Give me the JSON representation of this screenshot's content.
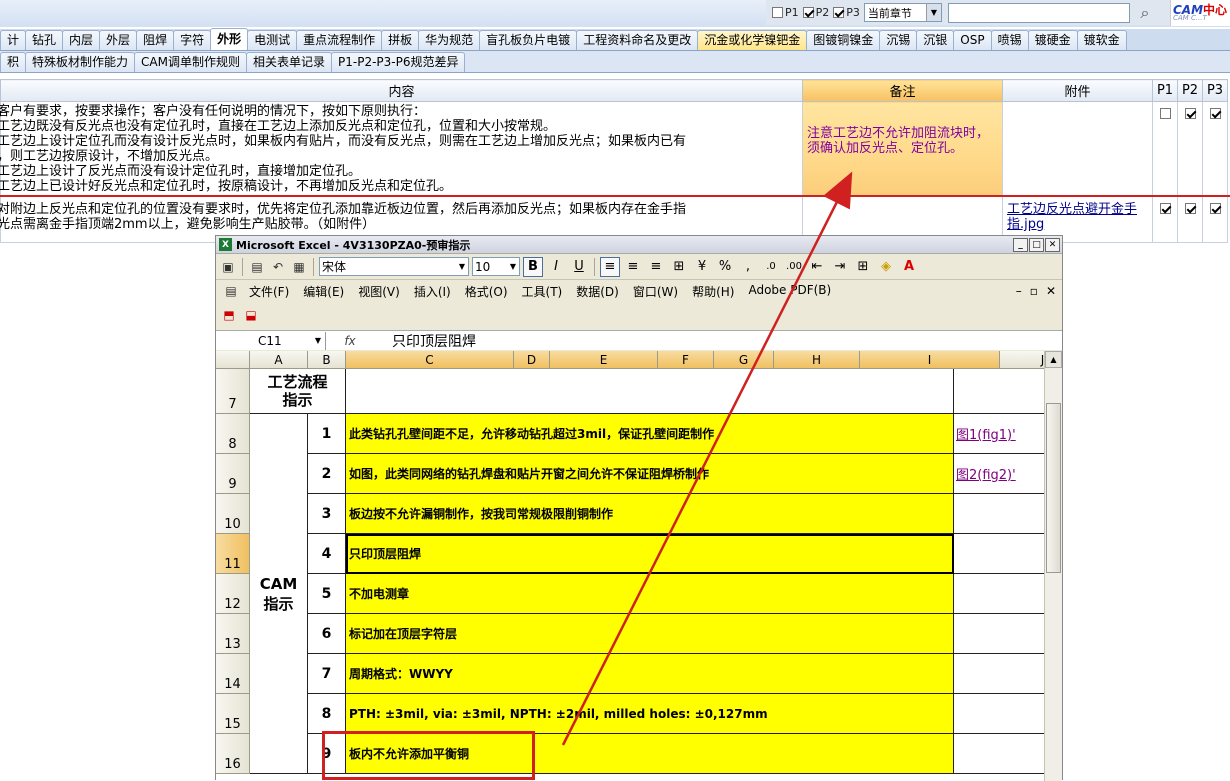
{
  "topctl": {
    "p1": "P1",
    "p2": "P2",
    "p3": "P3",
    "p1_checked": false,
    "p2_checked": true,
    "p3_checked": true,
    "chapter_select": "当前章节",
    "search_value": "",
    "logo_text": "CAM",
    "logo_cn": "中心",
    "logo_sub": "CAM   C...T"
  },
  "tabs_row1": [
    {
      "label": "计",
      "state": ""
    },
    {
      "label": "钻孔",
      "state": ""
    },
    {
      "label": "内层",
      "state": ""
    },
    {
      "label": "外层",
      "state": ""
    },
    {
      "label": "阻焊",
      "state": ""
    },
    {
      "label": "字符",
      "state": ""
    },
    {
      "label": "外形",
      "state": "active"
    },
    {
      "label": "电测试",
      "state": ""
    },
    {
      "label": "重点流程制作",
      "state": ""
    },
    {
      "label": "拼板",
      "state": ""
    },
    {
      "label": "华为规范",
      "state": ""
    },
    {
      "label": "盲孔板负片电镀",
      "state": ""
    },
    {
      "label": "工程资料命名及更改",
      "state": ""
    },
    {
      "label": "沉金或化学镍钯金",
      "state": "hl"
    },
    {
      "label": "图镀铜镍金",
      "state": ""
    },
    {
      "label": "沉锡",
      "state": ""
    },
    {
      "label": "沉银",
      "state": ""
    },
    {
      "label": "OSP",
      "state": ""
    },
    {
      "label": "喷锡",
      "state": ""
    },
    {
      "label": "镀硬金",
      "state": ""
    },
    {
      "label": "镀软金",
      "state": ""
    }
  ],
  "tabs_row2": [
    {
      "label": "积"
    },
    {
      "label": "特殊板材制作能力"
    },
    {
      "label": "CAM调单制作规则"
    },
    {
      "label": "相关表单记录"
    },
    {
      "label": "P1-P2-P3-P6规范差异"
    }
  ],
  "table": {
    "headers": {
      "content": "内容",
      "note": "备注",
      "attach": "附件",
      "p1": "P1",
      "p2": "P2",
      "p3": "P3"
    },
    "rows": [
      {
        "content": "客户有要求，按要求操作；客户没有任何说明的情况下，按如下原则执行：\n工艺边既没有反光点也没有定位孔时，直接在工艺边上添加反光点和定位孔，位置和大小按常规。\n工艺边上设计定位孔而没有设计反光点时，如果板内有贴片，而没有反光点，则需在工艺边上增加反光点；如果板内已有\n，则工艺边按原设计，不增加反光点。\n工艺边上设计了反光点而没有设计定位孔时，直接增加定位孔。\n工艺边上已设计好反光点和定位孔时，按原稿设计，不再增加反光点和定位孔。",
        "note": "注意工艺边不允许加阻流块时，须确认加反光点、定位孔。",
        "attach": "",
        "p1": false,
        "p2": true,
        "p3": true
      },
      {
        "content": "对附边上反光点和定位孔的位置没有要求时，优先将定位孔添加靠近板边位置，然后再添加反光点；如果板内存在金手指\n光点需离金手指顶端2mm以上，避免影响生产贴胶带。（如附件）",
        "note": "",
        "attach": "工艺边反光点避开金手指.jpg",
        "p1": true,
        "p2": true,
        "p3": true
      }
    ]
  },
  "excel": {
    "title": "Microsoft Excel - 4V3130PZA0-预审指示",
    "font_name": "宋体",
    "font_size": "10",
    "menu": [
      "文件(F)",
      "编辑(E)",
      "视图(V)",
      "插入(I)",
      "格式(O)",
      "工具(T)",
      "数据(D)",
      "窗口(W)",
      "帮助(H)",
      "Adobe PDF(B)"
    ],
    "name_box": "C11",
    "fx_label": "fx",
    "formula": "只印顶层阻焊",
    "columns": [
      "A",
      "B",
      "C",
      "D",
      "E",
      "F",
      "G",
      "H",
      "I",
      "J"
    ],
    "header_title": "工艺流程\n指示",
    "cam_label": "CAM\n指示",
    "rows": [
      {
        "row": "7",
        "num": "",
        "text": "",
        "link": ""
      },
      {
        "row": "8",
        "num": "1",
        "text": "此类钻孔孔壁间距不足，允许移动钻孔超过3mil，保证孔壁间距制作",
        "link": "图1(fig1)'"
      },
      {
        "row": "9",
        "num": "2",
        "text": "如图，此类同网络的钻孔焊盘和贴片开窗之间允许不保证阻焊桥制作",
        "link": "图2(fig2)'"
      },
      {
        "row": "10",
        "num": "3",
        "text": "板边按不允许漏铜制作，按我司常规极限削铜制作",
        "link": ""
      },
      {
        "row": "11",
        "num": "4",
        "text": "只印顶层阻焊",
        "link": ""
      },
      {
        "row": "12",
        "num": "5",
        "text": "不加电测章",
        "link": ""
      },
      {
        "row": "13",
        "num": "6",
        "text": "标记加在顶层字符层",
        "link": ""
      },
      {
        "row": "14",
        "num": "7",
        "text": "周期格式：WWYY",
        "link": ""
      },
      {
        "row": "15",
        "num": "8",
        "text": "PTH: ±3mil,  via: ±3mil,  NPTH: ±2mil,  milled holes: ±0,127mm",
        "link": ""
      },
      {
        "row": "16",
        "num": "9",
        "text": "板内不允许添加平衡铜",
        "link": ""
      }
    ]
  }
}
